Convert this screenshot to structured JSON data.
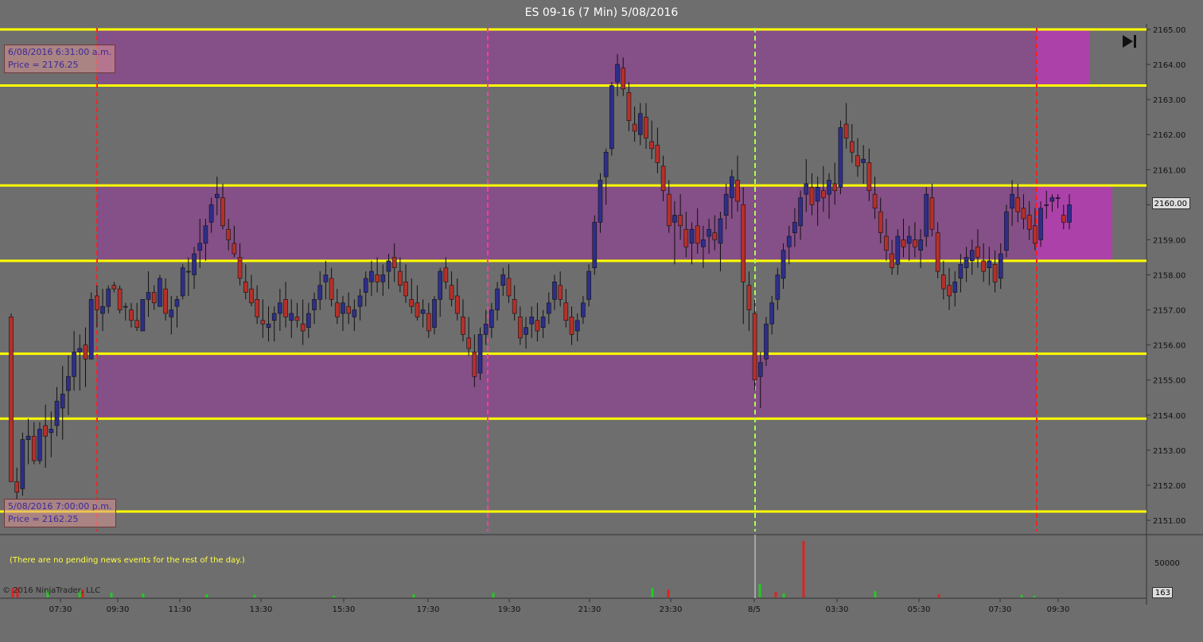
{
  "window": {
    "title": "ES 09-16 (7 Min)  5/08/2016"
  },
  "chart_data": {
    "type": "candlestick",
    "title": "ES 09-16 (7 Min)  5/08/2016",
    "ylim": [
      2150.6,
      2165.05
    ],
    "y_ticks": [
      2151,
      2152,
      2153,
      2154,
      2155,
      2156,
      2157,
      2158,
      2159,
      2160,
      2161,
      2162,
      2163,
      2164,
      2165
    ],
    "y_tick_labels": [
      "2151.00",
      "2152.00",
      "2153.00",
      "2154.00",
      "2155.00",
      "2156.00",
      "2157.00",
      "2158.00",
      "2159.00",
      "2160.00",
      "2161.00",
      "2162.00",
      "2163.00",
      "2164.00",
      "2165.00"
    ],
    "x_tick_labels": [
      "07:30",
      "09:30",
      "11:30",
      "13:30",
      "15:30",
      "17:30",
      "19:30",
      "21:30",
      "23:30",
      "8/5",
      "03:30",
      "05:30",
      "07:30",
      "09:30"
    ],
    "current_price_label": "2160.00",
    "horizontal_levels": [
      2165.0,
      2163.4,
      2160.55,
      2158.4,
      2155.75,
      2153.9,
      2151.25
    ],
    "shaded_zones": [
      {
        "from": 2163.4,
        "to": 2165.0
      },
      {
        "from": 2158.4,
        "to": 2160.55
      },
      {
        "from": 2153.9,
        "to": 2155.75
      }
    ],
    "vertical_markers": [
      {
        "time": "09:00",
        "style": "red-dashed"
      },
      {
        "time": "18:00",
        "style": "magenta-dashed"
      },
      {
        "time": "00:00",
        "style": "green-dashed"
      },
      {
        "time": "09:00 (8/5)",
        "style": "red-dashed"
      }
    ],
    "candles": [
      [
        2156.8,
        2156.9,
        2152.1,
        2152.1
      ],
      [
        2152.1,
        2152.5,
        2151.6,
        2151.8
      ],
      [
        2151.9,
        2153.5,
        2151.7,
        2153.3
      ],
      [
        2153.3,
        2153.9,
        2152.6,
        2153.4
      ],
      [
        2153.4,
        2153.8,
        2152.6,
        2152.7
      ],
      [
        2152.7,
        2153.8,
        2152.6,
        2153.6
      ],
      [
        2153.7,
        2154.3,
        2152.5,
        2153.4
      ],
      [
        2153.5,
        2154.1,
        2152.8,
        2153.6
      ],
      [
        2153.7,
        2154.8,
        2153.4,
        2154.4
      ],
      [
        2154.2,
        2155.4,
        2153.3,
        2154.6
      ],
      [
        2154.7,
        2155.7,
        2154.0,
        2155.1
      ],
      [
        2155.1,
        2156.4,
        2154.7,
        2155.8
      ],
      [
        2155.8,
        2156.3,
        2154.7,
        2155.9
      ],
      [
        2156.0,
        2156.5,
        2154.8,
        2155.6
      ],
      [
        2155.6,
        2157.5,
        2155.6,
        2157.3
      ],
      [
        2157.4,
        2157.7,
        2156.5,
        2157.0
      ],
      [
        2156.9,
        2157.6,
        2156.4,
        2157.1
      ],
      [
        2157.1,
        2157.7,
        2156.9,
        2157.6
      ],
      [
        2157.7,
        2157.8,
        2157.5,
        2157.6
      ],
      [
        2157.6,
        2157.7,
        2156.9,
        2157.0
      ],
      [
        2157.1,
        2157.2,
        2156.7,
        2157.1
      ],
      [
        2157.0,
        2157.2,
        2156.5,
        2156.7
      ],
      [
        2156.7,
        2157.2,
        2156.4,
        2156.5
      ],
      [
        2156.4,
        2157.3,
        2156.4,
        2157.3
      ],
      [
        2157.3,
        2158.1,
        2156.8,
        2157.5
      ],
      [
        2157.5,
        2157.7,
        2157.0,
        2157.2
      ],
      [
        2157.1,
        2158.0,
        2157.1,
        2157.9
      ],
      [
        2157.6,
        2157.9,
        2156.7,
        2156.9
      ],
      [
        2156.8,
        2157.4,
        2156.3,
        2157.0
      ],
      [
        2157.1,
        2157.4,
        2156.5,
        2157.3
      ],
      [
        2157.4,
        2158.3,
        2157.3,
        2158.2
      ],
      [
        2158.1,
        2158.5,
        2157.4,
        2158.1
      ],
      [
        2158.0,
        2158.8,
        2157.6,
        2158.6
      ],
      [
        2158.7,
        2159.6,
        2158.2,
        2158.9
      ],
      [
        2158.9,
        2159.6,
        2158.4,
        2159.4
      ],
      [
        2159.5,
        2160.2,
        2159.2,
        2160.0
      ],
      [
        2160.2,
        2160.8,
        2159.7,
        2160.3
      ],
      [
        2160.2,
        2160.6,
        2159.3,
        2159.4
      ],
      [
        2159.3,
        2159.6,
        2158.7,
        2159.0
      ],
      [
        2158.9,
        2159.4,
        2158.5,
        2158.6
      ],
      [
        2158.5,
        2158.9,
        2157.7,
        2157.9
      ],
      [
        2157.8,
        2158.3,
        2157.3,
        2157.5
      ],
      [
        2157.6,
        2158.0,
        2157.1,
        2157.2
      ],
      [
        2157.3,
        2157.7,
        2156.6,
        2156.8
      ],
      [
        2156.7,
        2157.3,
        2156.2,
        2156.6
      ],
      [
        2156.5,
        2157.1,
        2156.1,
        2156.6
      ],
      [
        2156.7,
        2157.1,
        2156.1,
        2156.9
      ],
      [
        2156.9,
        2157.6,
        2156.4,
        2157.2
      ],
      [
        2157.3,
        2157.8,
        2156.5,
        2156.8
      ],
      [
        2156.7,
        2157.3,
        2156.2,
        2156.9
      ],
      [
        2156.8,
        2157.2,
        2156.5,
        2156.7
      ],
      [
        2156.6,
        2157.3,
        2156.0,
        2156.4
      ],
      [
        2156.5,
        2157.2,
        2156.2,
        2156.9
      ],
      [
        2157.0,
        2157.5,
        2156.6,
        2157.3
      ],
      [
        2157.3,
        2158.1,
        2157.0,
        2157.7
      ],
      [
        2157.8,
        2158.4,
        2157.3,
        2158.0
      ],
      [
        2157.9,
        2158.2,
        2157.1,
        2157.3
      ],
      [
        2157.2,
        2157.6,
        2156.6,
        2156.8
      ],
      [
        2156.9,
        2157.4,
        2156.4,
        2157.2
      ],
      [
        2157.1,
        2157.5,
        2156.6,
        2156.9
      ],
      [
        2156.8,
        2157.3,
        2156.4,
        2157.0
      ],
      [
        2157.1,
        2157.6,
        2156.7,
        2157.4
      ],
      [
        2157.5,
        2158.1,
        2157.1,
        2157.9
      ],
      [
        2157.8,
        2158.4,
        2157.4,
        2158.1
      ],
      [
        2158.0,
        2158.5,
        2157.5,
        2157.8
      ],
      [
        2157.8,
        2158.3,
        2157.4,
        2158.0
      ],
      [
        2158.1,
        2158.6,
        2157.6,
        2158.4
      ],
      [
        2158.5,
        2158.9,
        2157.8,
        2158.2
      ],
      [
        2158.1,
        2158.5,
        2157.5,
        2157.7
      ],
      [
        2157.8,
        2158.3,
        2157.2,
        2157.4
      ],
      [
        2157.3,
        2157.9,
        2156.9,
        2157.1
      ],
      [
        2157.2,
        2157.7,
        2156.7,
        2156.8
      ],
      [
        2156.9,
        2157.3,
        2156.5,
        2157.0
      ],
      [
        2156.9,
        2157.2,
        2156.2,
        2156.4
      ],
      [
        2156.5,
        2157.4,
        2156.3,
        2157.3
      ],
      [
        2157.3,
        2158.2,
        2156.8,
        2158.1
      ],
      [
        2158.2,
        2158.5,
        2157.6,
        2157.8
      ],
      [
        2157.7,
        2158.1,
        2157.1,
        2157.3
      ],
      [
        2157.4,
        2157.9,
        2156.7,
        2156.9
      ],
      [
        2156.8,
        2157.3,
        2156.1,
        2156.3
      ],
      [
        2156.2,
        2156.8,
        2155.7,
        2155.9
      ],
      [
        2155.8,
        2156.3,
        2154.8,
        2155.1
      ],
      [
        2155.2,
        2156.5,
        2155.0,
        2156.3
      ],
      [
        2156.3,
        2157.0,
        2156.0,
        2156.6
      ],
      [
        2156.5,
        2157.2,
        2156.2,
        2157.0
      ],
      [
        2157.0,
        2157.8,
        2156.7,
        2157.6
      ],
      [
        2157.7,
        2158.2,
        2157.4,
        2158.0
      ],
      [
        2157.9,
        2158.3,
        2157.2,
        2157.4
      ],
      [
        2157.3,
        2157.7,
        2156.7,
        2156.9
      ],
      [
        2156.8,
        2157.1,
        2156.0,
        2156.2
      ],
      [
        2156.3,
        2156.8,
        2155.9,
        2156.5
      ],
      [
        2156.6,
        2157.1,
        2156.2,
        2156.8
      ],
      [
        2156.7,
        2157.2,
        2156.1,
        2156.4
      ],
      [
        2156.5,
        2157.0,
        2156.2,
        2156.8
      ],
      [
        2156.9,
        2157.5,
        2156.6,
        2157.2
      ],
      [
        2157.3,
        2158.0,
        2157.0,
        2157.8
      ],
      [
        2157.7,
        2158.1,
        2157.1,
        2157.3
      ],
      [
        2157.2,
        2157.6,
        2156.5,
        2156.7
      ],
      [
        2156.8,
        2157.1,
        2156.0,
        2156.3
      ],
      [
        2156.4,
        2156.9,
        2156.1,
        2156.7
      ],
      [
        2156.8,
        2157.4,
        2156.6,
        2157.2
      ],
      [
        2157.3,
        2158.3,
        2157.1,
        2158.1
      ],
      [
        2158.2,
        2159.7,
        2158.0,
        2159.5
      ],
      [
        2159.5,
        2160.9,
        2159.2,
        2160.7
      ],
      [
        2160.8,
        2161.6,
        2160.0,
        2161.5
      ],
      [
        2161.6,
        2163.5,
        2161.4,
        2163.4
      ],
      [
        2163.5,
        2164.3,
        2163.1,
        2164.0
      ],
      [
        2163.9,
        2164.2,
        2163.1,
        2163.3
      ],
      [
        2163.2,
        2163.5,
        2162.1,
        2162.4
      ],
      [
        2162.3,
        2162.8,
        2161.8,
        2162.1
      ],
      [
        2162.0,
        2162.9,
        2161.7,
        2162.6
      ],
      [
        2162.5,
        2162.9,
        2161.6,
        2161.9
      ],
      [
        2161.8,
        2162.4,
        2161.3,
        2161.6
      ],
      [
        2161.7,
        2162.2,
        2160.9,
        2161.2
      ],
      [
        2161.1,
        2161.4,
        2160.1,
        2160.4
      ],
      [
        2160.3,
        2160.7,
        2159.2,
        2159.4
      ],
      [
        2159.5,
        2160.1,
        2158.3,
        2159.7
      ],
      [
        2159.7,
        2160.3,
        2159.0,
        2159.4
      ],
      [
        2159.3,
        2159.8,
        2158.5,
        2158.8
      ],
      [
        2158.9,
        2159.5,
        2158.3,
        2159.3
      ],
      [
        2159.4,
        2159.9,
        2158.6,
        2158.9
      ],
      [
        2158.8,
        2159.4,
        2158.2,
        2159.0
      ],
      [
        2159.1,
        2159.6,
        2158.6,
        2159.3
      ],
      [
        2159.2,
        2159.7,
        2158.7,
        2159.0
      ],
      [
        2158.9,
        2159.8,
        2158.1,
        2159.6
      ],
      [
        2159.7,
        2160.6,
        2159.3,
        2160.3
      ],
      [
        2160.2,
        2161.0,
        2159.6,
        2160.8
      ],
      [
        2160.7,
        2161.4,
        2159.8,
        2160.1
      ],
      [
        2160.0,
        2160.5,
        2156.6,
        2157.8
      ],
      [
        2157.7,
        2158.1,
        2156.4,
        2157.0
      ],
      [
        2156.9,
        2157.3,
        2154.7,
        2155.0
      ],
      [
        2155.1,
        2155.8,
        2154.2,
        2155.5
      ],
      [
        2155.6,
        2156.8,
        2155.4,
        2156.6
      ],
      [
        2156.6,
        2157.4,
        2156.3,
        2157.2
      ],
      [
        2157.3,
        2158.2,
        2157.0,
        2158.0
      ],
      [
        2157.9,
        2158.9,
        2157.6,
        2158.7
      ],
      [
        2158.8,
        2159.4,
        2158.3,
        2159.1
      ],
      [
        2159.2,
        2159.9,
        2158.8,
        2159.5
      ],
      [
        2159.4,
        2160.4,
        2159.0,
        2160.2
      ],
      [
        2160.3,
        2161.3,
        2159.8,
        2160.6
      ],
      [
        2160.5,
        2160.9,
        2159.7,
        2160.0
      ],
      [
        2160.1,
        2160.8,
        2159.4,
        2160.5
      ],
      [
        2160.4,
        2161.1,
        2159.8,
        2160.2
      ],
      [
        2160.3,
        2160.9,
        2159.6,
        2160.7
      ],
      [
        2160.6,
        2161.2,
        2160.0,
        2160.4
      ],
      [
        2160.5,
        2162.4,
        2160.3,
        2162.2
      ],
      [
        2162.3,
        2162.9,
        2161.6,
        2161.9
      ],
      [
        2161.8,
        2162.3,
        2161.2,
        2161.5
      ],
      [
        2161.4,
        2161.9,
        2160.8,
        2161.1
      ],
      [
        2161.2,
        2161.7,
        2160.6,
        2161.3
      ],
      [
        2161.2,
        2161.6,
        2160.1,
        2160.4
      ],
      [
        2160.3,
        2160.8,
        2159.6,
        2159.9
      ],
      [
        2159.8,
        2160.2,
        2158.9,
        2159.2
      ],
      [
        2159.1,
        2159.6,
        2158.4,
        2158.7
      ],
      [
        2158.6,
        2159.0,
        2158.0,
        2158.2
      ],
      [
        2158.3,
        2159.3,
        2158.0,
        2159.1
      ],
      [
        2159.0,
        2159.6,
        2158.5,
        2158.8
      ],
      [
        2158.9,
        2159.4,
        2158.4,
        2159.1
      ],
      [
        2159.0,
        2159.5,
        2158.5,
        2158.8
      ],
      [
        2158.7,
        2159.3,
        2158.2,
        2159.0
      ],
      [
        2159.1,
        2160.5,
        2158.8,
        2160.3
      ],
      [
        2160.2,
        2160.6,
        2159.1,
        2159.3
      ],
      [
        2159.2,
        2159.5,
        2157.9,
        2158.1
      ],
      [
        2158.0,
        2158.4,
        2157.3,
        2157.6
      ],
      [
        2157.7,
        2158.2,
        2157.0,
        2157.4
      ],
      [
        2157.5,
        2158.1,
        2157.1,
        2157.8
      ],
      [
        2157.9,
        2158.6,
        2157.5,
        2158.3
      ],
      [
        2158.2,
        2158.8,
        2157.8,
        2158.5
      ],
      [
        2158.4,
        2159.0,
        2158.0,
        2158.7
      ],
      [
        2158.8,
        2159.3,
        2158.2,
        2158.5
      ],
      [
        2158.4,
        2158.9,
        2157.8,
        2158.1
      ],
      [
        2158.2,
        2158.8,
        2157.7,
        2158.4
      ],
      [
        2158.3,
        2158.7,
        2157.5,
        2157.8
      ],
      [
        2157.9,
        2158.9,
        2157.6,
        2158.6
      ],
      [
        2158.7,
        2160.0,
        2158.5,
        2159.8
      ],
      [
        2159.9,
        2160.7,
        2159.4,
        2160.3
      ],
      [
        2160.2,
        2160.6,
        2159.5,
        2159.8
      ],
      [
        2159.9,
        2160.3,
        2159.3,
        2159.6
      ],
      [
        2159.7,
        2160.1,
        2159.0,
        2159.3
      ],
      [
        2159.4,
        2159.9,
        2158.7,
        2158.9
      ],
      [
        2159.0,
        2160.1,
        2158.8,
        2159.9
      ],
      [
        2160.0,
        2160.4,
        2159.6,
        2160.0
      ],
      [
        2160.1,
        2160.3,
        2159.8,
        2160.2
      ],
      [
        2160.2,
        2160.3,
        2159.9,
        2160.2
      ],
      [
        2159.7,
        2160.0,
        2159.3,
        2159.5
      ],
      [
        2159.5,
        2160.3,
        2159.3,
        2160.0
      ]
    ],
    "volume": [
      {
        "v": 12000,
        "up": false
      },
      {
        "v": 13000,
        "up": false
      },
      {
        "v": 9000,
        "up": true
      },
      {
        "v": 8000,
        "up": true
      },
      {
        "v": 10000,
        "up": false
      },
      {
        "v": 6000,
        "up": true
      },
      {
        "v": 5000,
        "up": true
      },
      {
        "v": 4000,
        "up": true
      },
      {
        "v": 3000,
        "up": true
      },
      {
        "v": 2000,
        "up": true
      },
      {
        "v": 4000,
        "up": true
      },
      {
        "v": 6000,
        "up": true
      },
      {
        "v": 12000,
        "up": true
      },
      {
        "v": 10000,
        "up": false
      },
      {
        "v": 17000,
        "up": true
      },
      {
        "v": 7000,
        "up": false
      },
      {
        "v": 5000,
        "up": true
      },
      {
        "v": 72000,
        "up": false
      },
      {
        "v": 8000,
        "up": true
      },
      {
        "v": 4000,
        "up": false
      },
      {
        "v": 3000,
        "up": true
      },
      {
        "v": 2000,
        "up": true
      }
    ],
    "volume_ylim": [
      0,
      72000
    ],
    "volume_tick_label": "50000",
    "current_volume_label": "163",
    "info_boxes": [
      {
        "line1": "6/08/2016 6:31:00 a.m.",
        "line2": "Price = 2176.25"
      },
      {
        "line1": "5/08/2016 7:00:00 p.m.",
        "line2": "Price = 2162.25"
      }
    ]
  },
  "footer": {
    "news": "(There are no pending news events for the rest of the day.)",
    "copyright": "© 2016 NinjaTrader, LLC"
  },
  "colors": {
    "up": "#2e2e8a",
    "down": "#b5302a",
    "zone": "#8a4a8c",
    "level": "#ffff00",
    "vol_up": "#22cc22",
    "vol_down": "#dd2222"
  }
}
